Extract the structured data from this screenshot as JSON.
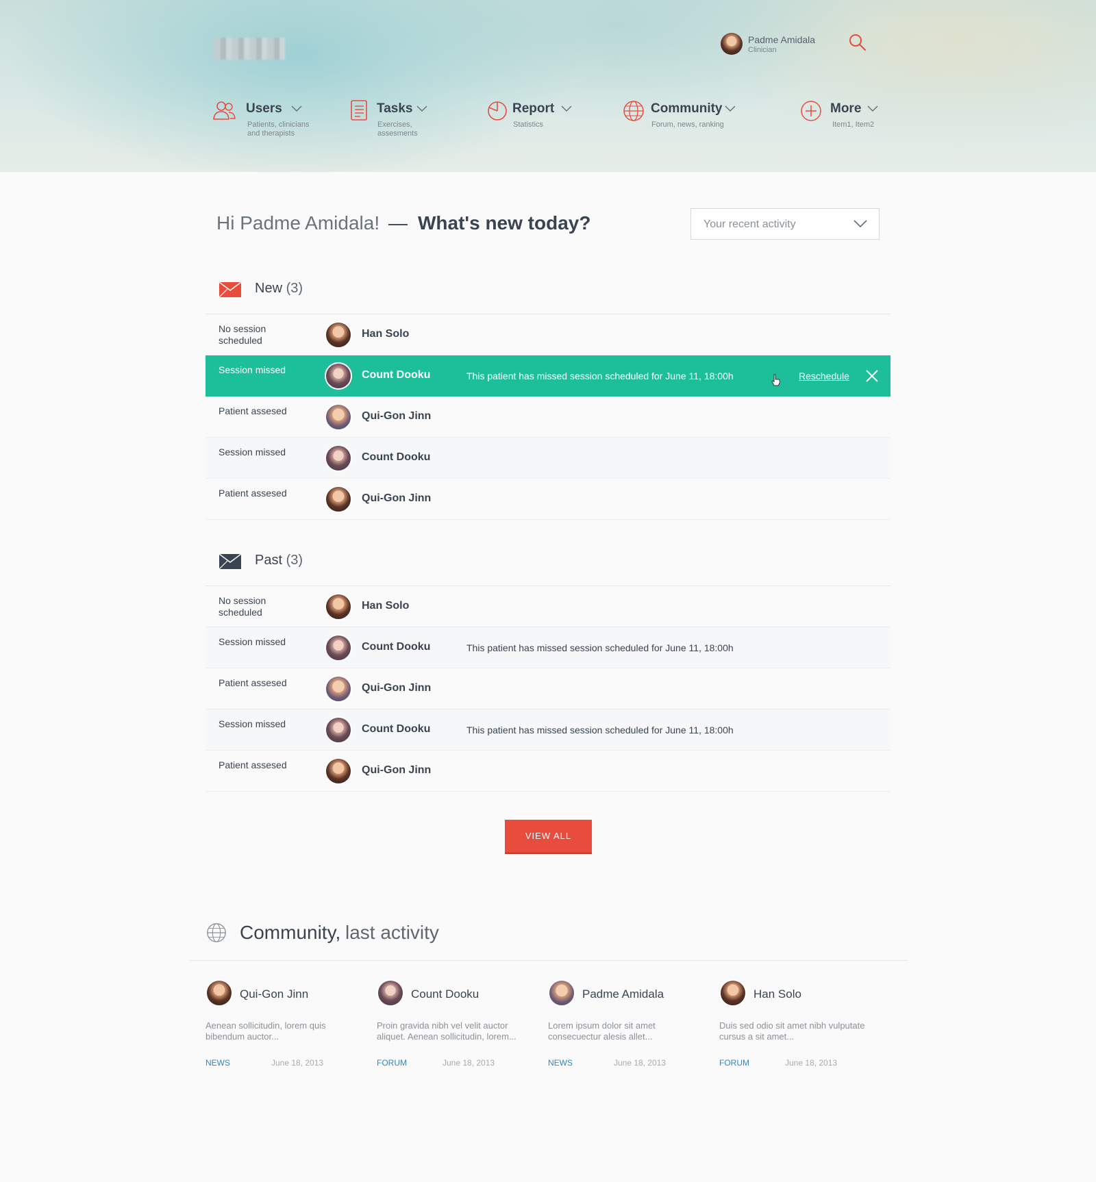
{
  "header": {
    "user": {
      "name": "Padme Amidala",
      "role": "Clinician"
    },
    "nav": [
      {
        "label": "Users",
        "sub": "Patients, clinicians and therapists",
        "icon": "users-icon"
      },
      {
        "label": "Tasks",
        "sub": "Exercises, assesments",
        "icon": "tasks-icon"
      },
      {
        "label": "Report",
        "sub": "Statistics",
        "icon": "report-icon"
      },
      {
        "label": "Community",
        "sub": "Forum, news, ranking",
        "icon": "globe-icon"
      },
      {
        "label": "More",
        "sub": "Item1, Item2",
        "icon": "plus-circle-icon"
      }
    ]
  },
  "greeting": {
    "hello": "Hi Padme Amidala!",
    "dash": "—",
    "question": "What's new today?",
    "filter_value": "Your recent activity"
  },
  "new_section": {
    "title": "New",
    "count": "(3)",
    "rows": [
      {
        "status": "No session scheduled",
        "name": "Han Solo",
        "message": ""
      },
      {
        "status": "Session missed",
        "name": "Count Dooku",
        "message": "This patient has missed session scheduled for June 11, 18:00h",
        "action": "Reschedule"
      },
      {
        "status": "Patient assesed",
        "name": "Qui-Gon Jinn",
        "message": ""
      },
      {
        "status": "Session missed",
        "name": "Count Dooku",
        "message": ""
      },
      {
        "status": "Patient assesed",
        "name": "Qui-Gon Jinn",
        "message": ""
      }
    ]
  },
  "past_section": {
    "title": "Past",
    "count": "(3)",
    "rows": [
      {
        "status": "No session scheduled",
        "name": "Han Solo",
        "message": ""
      },
      {
        "status": "Session missed",
        "name": "Count Dooku",
        "message": "This patient has missed session scheduled for June 11, 18:00h"
      },
      {
        "status": "Patient assesed",
        "name": "Qui-Gon Jinn",
        "message": ""
      },
      {
        "status": "Session missed",
        "name": "Count Dooku",
        "message": "This patient has missed session scheduled for June 11, 18:00h"
      },
      {
        "status": "Patient assesed",
        "name": "Qui-Gon Jinn",
        "message": ""
      }
    ]
  },
  "view_all_label": "VIEW ALL",
  "community": {
    "title_bold": "Community,",
    "title_light": "last activity",
    "cards": [
      {
        "name": "Qui-Gon Jinn",
        "excerpt": "Aenean sollicitudin, lorem quis bibendum auctor...",
        "tag": "NEWS",
        "date": "June 18, 2013"
      },
      {
        "name": "Count Dooku",
        "excerpt": "Proin gravida nibh vel velit auctor aliquet. Aenean sollicitudin, lorem...",
        "tag": "FORUM",
        "date": "June 18, 2013"
      },
      {
        "name": "Padme Amidala",
        "excerpt": "Lorem ipsum dolor sit amet consecuectur alesis allet...",
        "tag": "NEWS",
        "date": "June 18, 2013"
      },
      {
        "name": "Han Solo",
        "excerpt": "Duis sed odio sit amet nibh vulputate cursus a sit amet...",
        "tag": "FORUM",
        "date": "June 18, 2013"
      }
    ]
  },
  "colors": {
    "accent": "#e74c3c",
    "highlight_row": "#1dbf9b",
    "link": "#2f86c8",
    "text_dark": "#3a4450"
  }
}
